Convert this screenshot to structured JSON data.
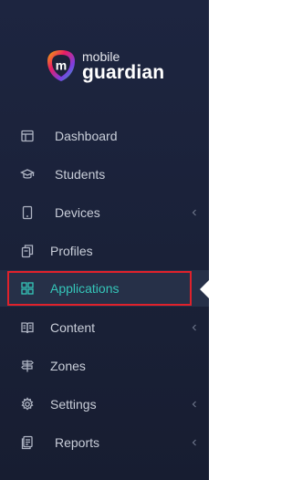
{
  "brand": {
    "line1": "mobile",
    "line2": "guardian",
    "logo_letter": "m"
  },
  "colors": {
    "sidebar_bg": "#1b2239",
    "text": "#c9ced9",
    "active_text": "#35c6b9",
    "active_bg": "#263048",
    "highlight_border": "#e0212b"
  },
  "nav": {
    "items": [
      {
        "label": "Dashboard",
        "icon": "layout-icon",
        "has_submenu": false,
        "active": false
      },
      {
        "label": "Students",
        "icon": "graduation-cap-icon",
        "has_submenu": false,
        "active": false
      },
      {
        "label": "Devices",
        "icon": "tablet-icon",
        "has_submenu": true,
        "active": false
      },
      {
        "label": "Profiles",
        "icon": "copy-icon",
        "has_submenu": false,
        "active": false
      },
      {
        "label": "Applications",
        "icon": "grid-icon",
        "has_submenu": false,
        "active": true
      },
      {
        "label": "Content",
        "icon": "book-icon",
        "has_submenu": true,
        "active": false
      },
      {
        "label": "Zones",
        "icon": "signpost-icon",
        "has_submenu": false,
        "active": false
      },
      {
        "label": "Settings",
        "icon": "gear-icon",
        "has_submenu": true,
        "active": false
      },
      {
        "label": "Reports",
        "icon": "report-icon",
        "has_submenu": true,
        "active": false
      }
    ]
  }
}
